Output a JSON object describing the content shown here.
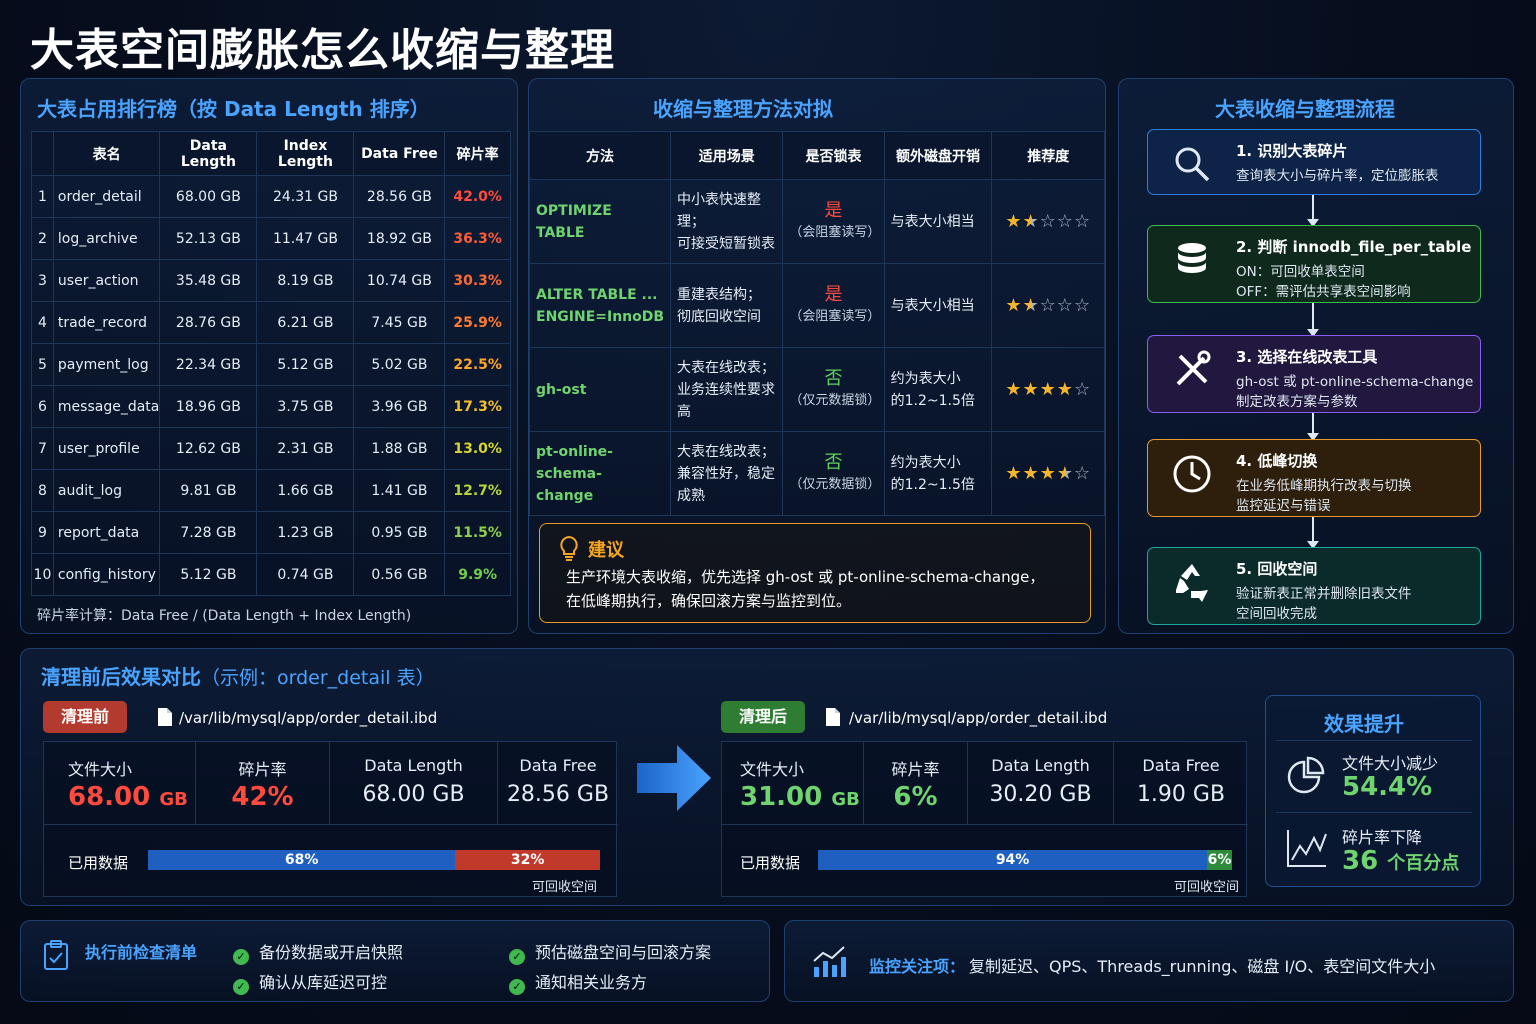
{
  "title": "大表空间膨胀怎么收缩与整理",
  "ranking": {
    "title": "大表占用排行榜（按 Data Length 排序）",
    "headers": [
      "",
      "表名",
      "Data Length",
      "Index Length",
      "Data Free",
      "碎片率"
    ],
    "rows": [
      [
        "1",
        "order_detail",
        "68.00 GB",
        "24.31 GB",
        "28.56 GB",
        "42.0%"
      ],
      [
        "2",
        "log_archive",
        "52.13 GB",
        "11.47 GB",
        "18.92 GB",
        "36.3%"
      ],
      [
        "3",
        "user_action",
        "35.48 GB",
        "8.19 GB",
        "10.74 GB",
        "30.3%"
      ],
      [
        "4",
        "trade_record",
        "28.76 GB",
        "6.21 GB",
        "7.45 GB",
        "25.9%"
      ],
      [
        "5",
        "payment_log",
        "22.34 GB",
        "5.12 GB",
        "5.02 GB",
        "22.5%"
      ],
      [
        "6",
        "message_data",
        "18.96 GB",
        "3.75 GB",
        "3.96 GB",
        "17.3%"
      ],
      [
        "7",
        "user_profile",
        "12.62 GB",
        "2.31 GB",
        "1.88 GB",
        "13.0%"
      ],
      [
        "8",
        "audit_log",
        "9.81 GB",
        "1.66 GB",
        "1.41 GB",
        "12.7%"
      ],
      [
        "9",
        "report_data",
        "7.28 GB",
        "1.23 GB",
        "0.95 GB",
        "11.5%"
      ],
      [
        "10",
        "config_history",
        "5.12 GB",
        "0.74 GB",
        "0.56 GB",
        "9.9%"
      ]
    ],
    "frag_colors": [
      "#ff4a3d",
      "#ff5a3a",
      "#ff6a34",
      "#ff7a2e",
      "#ffa62a",
      "#f5c02a",
      "#d8d62a",
      "#b8d63a",
      "#8fd04a",
      "#6fcf4f"
    ],
    "note": "碎片率计算：Data Free / (Data Length + Index Length)"
  },
  "methods": {
    "title": "收缩与整理方法对拟",
    "headers": [
      "方法",
      "适用场景",
      "是否锁表",
      "额外磁盘开销",
      "推荐度"
    ],
    "rows": [
      {
        "name1": "OPTIMIZE TABLE",
        "name2": "",
        "scene1": "中小表快速整理；",
        "scene2": "可接受短暂锁表",
        "lock": "是",
        "lock_sub": "（会阻塞读写）",
        "disk1": "与表大小相当",
        "disk2": "",
        "rating": 1.5
      },
      {
        "name1": "ALTER TABLE ...",
        "name2": "ENGINE=InnoDB",
        "scene1": "重建表结构；",
        "scene2": "彻底回收空间",
        "lock": "是",
        "lock_sub": "（会阻塞读写）",
        "disk1": "与表大小相当",
        "disk2": "",
        "rating": 1.5
      },
      {
        "name1": "gh-ost",
        "name2": "",
        "scene1": "大表在线改表；",
        "scene2": "业务连续性要求高",
        "lock": "否",
        "lock_sub": "（仅元数据锁）",
        "disk1": "约为表大小",
        "disk2": "的1.2~1.5倍",
        "rating": 4
      },
      {
        "name1": "pt-online-schema-",
        "name2": "change",
        "scene1": "大表在线改表；",
        "scene2": "兼容性好，稳定成熟",
        "lock": "否",
        "lock_sub": "（仅元数据锁）",
        "disk1": "约为表大小",
        "disk2": "的1.2~1.5倍",
        "rating": 3.5
      }
    ],
    "advice_title": "建议",
    "advice_line1": "生产环境大表收缩，优先选择 gh-ost 或 pt-online-schema-change，",
    "advice_line2": "在低峰期执行，确保回滚方案与监控到位。"
  },
  "flow": {
    "title": "大表收缩与整理流程",
    "steps": [
      {
        "title": "1. 识别大表碎片",
        "line1": "查询表大小与碎片率，定位膨胀表",
        "line2": "",
        "icon": "search-icon",
        "color": "#2f7de0",
        "bg": "#0d2448"
      },
      {
        "title": "2. 判断 innodb_file_per_table",
        "line1": "ON：可回收单表空间",
        "line2": "OFF：需评估共享表空间影响",
        "icon": "database-icon",
        "color": "#3fb950",
        "bg": "#0f2a1c"
      },
      {
        "title": "3. 选择在线改表工具",
        "line1": "gh-ost 或 pt-online-schema-change",
        "line2": "制定改表方案与参数",
        "icon": "tools-icon",
        "color": "#8b5cf6",
        "bg": "#22173f"
      },
      {
        "title": "4. 低峰切换",
        "line1": "在业务低峰期执行改表与切换",
        "line2": "监控延迟与错误",
        "icon": "clock-icon",
        "color": "#e89a2c",
        "bg": "#2d1f0c"
      },
      {
        "title": "5. 回收空间",
        "line1": "验证新表正常并删除旧表文件",
        "line2": "空间回收完成",
        "icon": "recycle-icon",
        "color": "#1fa89a",
        "bg": "#0b2a2a"
      }
    ]
  },
  "compare": {
    "title": "清理前后效果对比",
    "subtitle": "（示例：order_detail 表）",
    "before": {
      "tag": "清理前",
      "path": "/var/lib/mysql/app/order_detail.ibd",
      "metrics": [
        {
          "label": "文件大小",
          "value": "68.00",
          "unit": "GB"
        },
        {
          "label": "碎片率",
          "value": "42%",
          "unit": ""
        },
        {
          "label": "Data Length",
          "value": "68.00 GB",
          "unit": ""
        },
        {
          "label": "Data Free",
          "value": "28.56 GB",
          "unit": ""
        }
      ],
      "used_label": "已用数据",
      "used_pct": 68,
      "used_text": "68%",
      "free_text": "32%",
      "reclaim": "可回收空间"
    },
    "after": {
      "tag": "清理后",
      "path": "/var/lib/mysql/app/order_detail.ibd",
      "metrics": [
        {
          "label": "文件大小",
          "value": "31.00",
          "unit": "GB"
        },
        {
          "label": "碎片率",
          "value": "6%",
          "unit": ""
        },
        {
          "label": "Data Length",
          "value": "30.20 GB",
          "unit": ""
        },
        {
          "label": "Data Free",
          "value": "1.90 GB",
          "unit": ""
        }
      ],
      "used_label": "已用数据",
      "used_pct": 94,
      "used_text": "94%",
      "free_text": "6%",
      "reclaim": "可回收空间"
    },
    "effect": {
      "title": "效果提升",
      "item1_label": "文件大小减少",
      "item1_value": "54.4%",
      "item2_label": "碎片率下降",
      "item2_value": "36",
      "item2_unit": "个百分点"
    }
  },
  "checklist": {
    "title": "执行前检查清单",
    "items": [
      "备份数据或开启快照",
      "预估磁盘空间与回滚方案",
      "确认从库延迟可控",
      "通知相关业务方"
    ]
  },
  "monitor": {
    "label": "监控关注项：",
    "text": "复制延迟、QPS、Threads_running、磁盘 I/O、表空间文件大小"
  },
  "colors": {
    "accent": "#4aa3ff",
    "red": "#ff4a3d",
    "green": "#6fd36f",
    "bar_blue": "#1f5fbf",
    "bar_red": "#c0392b",
    "bar_green": "#2e8b3a"
  }
}
